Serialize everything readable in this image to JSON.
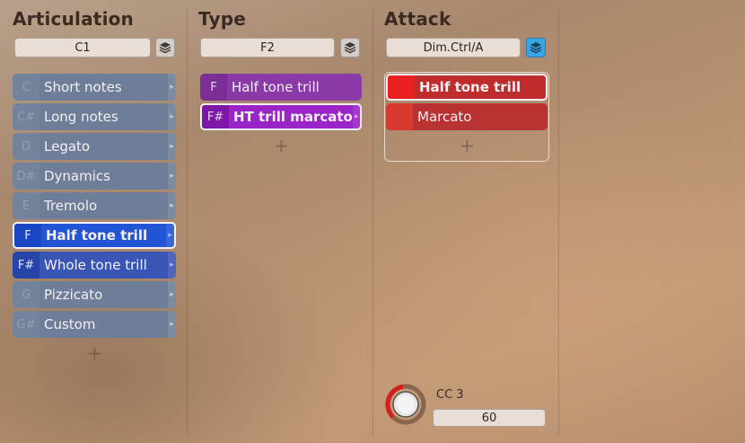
{
  "articulation": {
    "title": "Articulation",
    "selector_value": "C1",
    "stack_icon": "layers-icon",
    "add_label": "+",
    "items": [
      {
        "key": "C",
        "label": "Short notes"
      },
      {
        "key": "C#",
        "label": "Long notes"
      },
      {
        "key": "D",
        "label": "Legato"
      },
      {
        "key": "D#",
        "label": "Dynamics"
      },
      {
        "key": "E",
        "label": "Tremolo"
      },
      {
        "key": "F",
        "label": "Half tone trill"
      },
      {
        "key": "F#",
        "label": "Whole tone trill"
      },
      {
        "key": "G",
        "label": "Pizzicato"
      },
      {
        "key": "G#",
        "label": "Custom"
      }
    ],
    "selected_index": 5
  },
  "type": {
    "title": "Type",
    "selector_value": "F2",
    "stack_icon": "layers-icon",
    "add_label": "+",
    "items": [
      {
        "key": "F",
        "label": "Half tone trill"
      },
      {
        "key": "F#",
        "label": "HT trill marcato"
      }
    ],
    "selected_index": 1
  },
  "attack": {
    "title": "Attack",
    "selector_value": "Dim.Ctrl/A",
    "stack_icon": "layers-icon",
    "add_label": "+",
    "items": [
      {
        "label": "Half tone trill"
      },
      {
        "label": "Marcato"
      }
    ],
    "selected_index": 0,
    "knob": {
      "label": "CC 3",
      "value": "60",
      "fraction": 0.47
    }
  },
  "colors": {
    "slot_gray": "#6f7e98",
    "slot_active_blue": "#2155d6",
    "slot_blue": "#3a56b4",
    "type_purple": "#8a3aa6",
    "type_active": "#9a24c8",
    "attack_red": "#cc2a2a",
    "attack_active": "#ea2020",
    "stack_active": "#3aa6e6",
    "knob_ring": "#d41f1f"
  }
}
